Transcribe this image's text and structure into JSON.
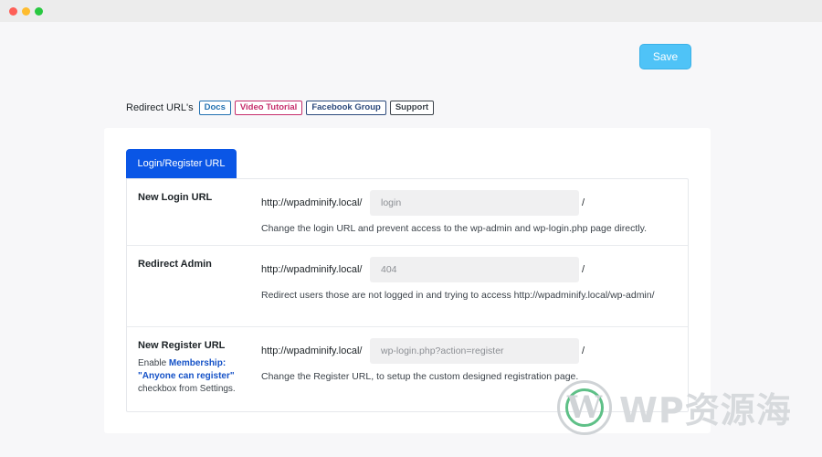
{
  "window": {
    "controls": [
      "close",
      "minimize",
      "maximize"
    ]
  },
  "toolbar": {
    "save_label": "Save"
  },
  "heading": {
    "title": "Redirect URL's",
    "links": [
      "Docs",
      "Video Tutorial",
      "Facebook Group",
      "Support"
    ]
  },
  "tabs": [
    {
      "label": "Login/Register URL",
      "active": true
    }
  ],
  "rows": [
    {
      "label": "New Login URL",
      "prefix": "http://wpadminify.local/",
      "placeholder": "login",
      "suffix": "/",
      "description": "Change the login URL and prevent access to the wp-admin and wp-login.php page directly."
    },
    {
      "label": "Redirect Admin",
      "prefix": "http://wpadminify.local/",
      "placeholder": "404",
      "suffix": "/",
      "description": "Redirect users those are not logged in and trying to access http://wpadminify.local/wp-admin/"
    },
    {
      "label": "New Register URL",
      "sub_before": "Enable ",
      "sub_highlight": "Membership: \"Anyone can register\"",
      "sub_after": " checkbox from Settings.",
      "prefix": "http://wpadminify.local/",
      "placeholder": "wp-login.php?action=register",
      "suffix": "/",
      "description": "Change the Register URL, to setup the custom designed registration page."
    }
  ],
  "watermark": {
    "text": "WP资源海"
  },
  "colors": {
    "accent": "#0a56e6",
    "save": "#4fc3f7",
    "highlight": "#1552c7"
  }
}
